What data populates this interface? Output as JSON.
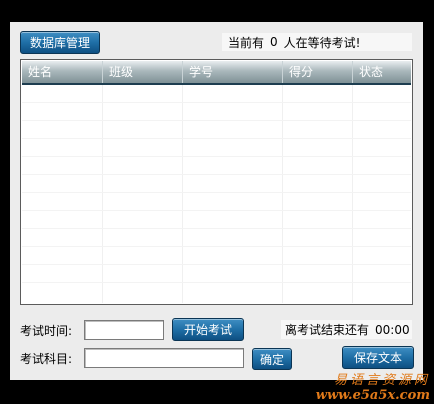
{
  "toolbar": {
    "db_manage_label": "数据库管理"
  },
  "status": {
    "waiting_prefix": "当前有",
    "waiting_count": "0",
    "waiting_suffix": "人在等待考试!"
  },
  "table": {
    "columns": [
      "姓名",
      "班级",
      "学号",
      "得分",
      "状态"
    ],
    "rows": []
  },
  "exam": {
    "time_label": "考试时间:",
    "time_value": "",
    "start_label": "开始考试",
    "remaining_label": "离考试结束还有",
    "remaining_value": "00:00",
    "subject_label": "考试科目:",
    "subject_value": "",
    "confirm_label": "确定",
    "save_label": "保存文本"
  },
  "watermark": {
    "chinese": "易语言资源网",
    "url": "www.e5a5x.com"
  },
  "colors": {
    "button": "#1f6fa6",
    "header": "#8a9ca1",
    "accent": "#e07a1a"
  }
}
